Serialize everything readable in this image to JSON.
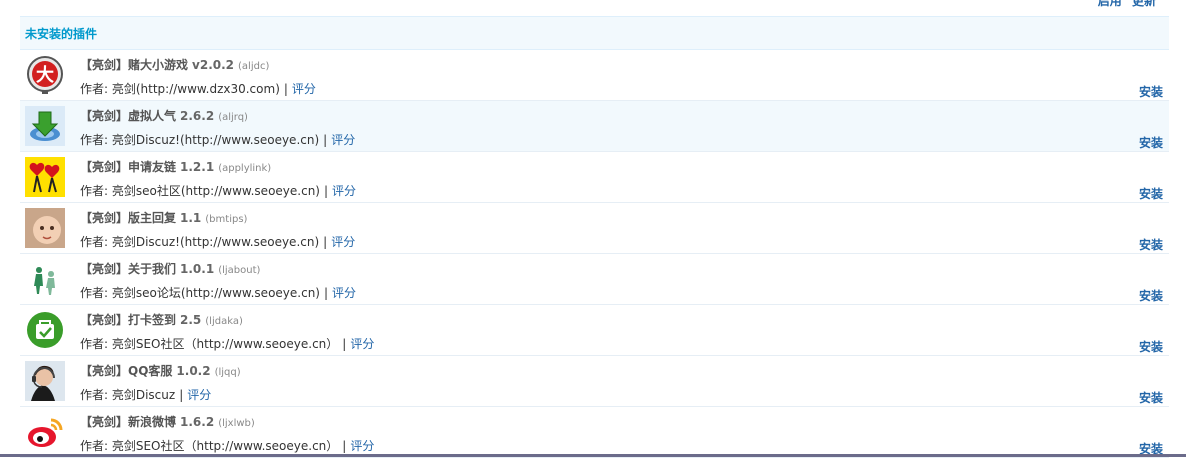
{
  "top_links": {
    "left": "启用",
    "right": "更新"
  },
  "section": {
    "title": "未安装的插件"
  },
  "plugins": [
    {
      "name": "【亮剑】赌大小游戏",
      "version": "v2.0.2",
      "id": "(aljdc)",
      "author": "作者: 亮剑(http://www.dzx30.com)",
      "sep": "|",
      "rate": "评分",
      "install": "安装",
      "icon": "dice-big-character-icon"
    },
    {
      "name": "【亮剑】虚拟人气",
      "version": "2.6.2",
      "id": "(aljrq)",
      "author": "作者: 亮剑Discuz!(http://www.seoeye.cn)",
      "sep": "|",
      "rate": "评分",
      "install": "安装",
      "icon": "download-globe-icon"
    },
    {
      "name": "【亮剑】申请友链",
      "version": "1.2.1",
      "id": "(applylink)",
      "author": "作者: 亮剑seo社区(http://www.seoeye.cn)",
      "sep": "|",
      "rate": "评分",
      "install": "安装",
      "icon": "heart-balloons-icon"
    },
    {
      "name": "【亮剑】版主回复",
      "version": "1.1",
      "id": "(bmtips)",
      "author": "作者: 亮剑Discuz!(http://www.seoeye.cn)",
      "sep": "|",
      "rate": "评分",
      "install": "安装",
      "icon": "baby-photo-icon"
    },
    {
      "name": "【亮剑】关于我们",
      "version": "1.0.1",
      "id": "(ljabout)",
      "author": "作者: 亮剑seo论坛(http://www.seoeye.cn)",
      "sep": "|",
      "rate": "评分",
      "install": "安装",
      "icon": "figures-icon"
    },
    {
      "name": "【亮剑】打卡签到",
      "version": "2.5",
      "id": "(ljdaka)",
      "author": "作者: 亮剑SEO社区（http://www.seoeye.cn）",
      "sep": "|",
      "rate": "评分",
      "install": "安装",
      "icon": "checkin-bag-icon"
    },
    {
      "name": "【亮剑】QQ客服",
      "version": "1.0.2",
      "id": "(ljqq)",
      "author": "作者: 亮剑Discuz",
      "sep": "|",
      "rate": "评分",
      "install": "安装",
      "icon": "headset-agent-icon"
    },
    {
      "name": "【亮剑】新浪微博",
      "version": "1.6.2",
      "id": "(ljxlwb)",
      "author": "作者: 亮剑SEO社区（http://www.seoeye.cn）",
      "sep": "|",
      "rate": "评分",
      "install": "安装",
      "icon": "weibo-icon"
    }
  ],
  "colors": {
    "link": "#2366a8",
    "header_text": "#0099cc",
    "header_bg": "#f2f9fd"
  }
}
